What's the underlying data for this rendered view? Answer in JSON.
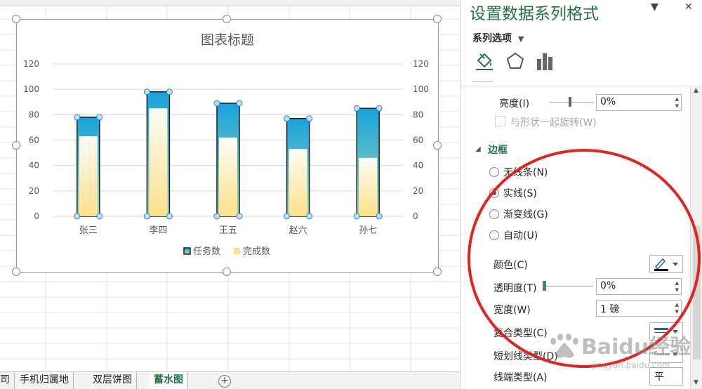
{
  "chart_data": {
    "type": "bar",
    "title": "图表标题",
    "categories": [
      "张三",
      "李四",
      "王五",
      "赵六",
      "孙七"
    ],
    "series": [
      {
        "name": "任务数",
        "values": [
          78,
          98,
          89,
          77,
          85
        ]
      },
      {
        "name": "完成数",
        "values": [
          63,
          85,
          62,
          53,
          46
        ]
      }
    ],
    "ylim": [
      0,
      120
    ],
    "yticks": [
      0,
      20,
      40,
      60,
      80,
      100,
      120
    ],
    "secondary_axis_ticks": [
      0,
      20,
      40,
      60,
      80,
      100,
      120
    ],
    "grid": true,
    "legend_position": "bottom"
  },
  "sheet_tabs": [
    {
      "label": "司",
      "active": false
    },
    {
      "label": "手机归属地",
      "active": false
    },
    {
      "label": "双层饼图",
      "active": false
    },
    {
      "label": "蓄水图",
      "active": true
    }
  ],
  "add_sheet_symbol": "+",
  "pane": {
    "title": "设置数据系列格式",
    "series_options_label": "系列选项",
    "tab_icons": [
      "paint-bucket-icon",
      "pentagon-icon",
      "bar-chart-icon"
    ],
    "brightness": {
      "label": "亮度(I)",
      "value": "0%"
    },
    "rotate_with_shape_label": "与形状一起旋转(W)",
    "border_section_label": "边框",
    "border_options": [
      {
        "label": "无线条(N)",
        "checked": false
      },
      {
        "label": "实线(S)",
        "checked": true
      },
      {
        "label": "渐变线(G)",
        "checked": false
      },
      {
        "label": "自动(U)",
        "checked": false
      }
    ],
    "color_label": "颜色(C)",
    "transparency": {
      "label": "透明度(T)",
      "value": "0%"
    },
    "width": {
      "label": "宽度(W)",
      "value": "1 磅"
    },
    "compound_type_label": "复合类型(C)",
    "dash_type_label": "短划线类型(D)",
    "cap_type_label": "线端类型(A)",
    "cap_type_value": "平"
  },
  "watermark": {
    "text": "Baidu经验",
    "url": "jingyan.baidu.com"
  },
  "colors": {
    "accent": "#217346",
    "annotation": "#e0241f",
    "bar_top": "#1aa3d9",
    "bar_fill": "#fce8a8"
  }
}
